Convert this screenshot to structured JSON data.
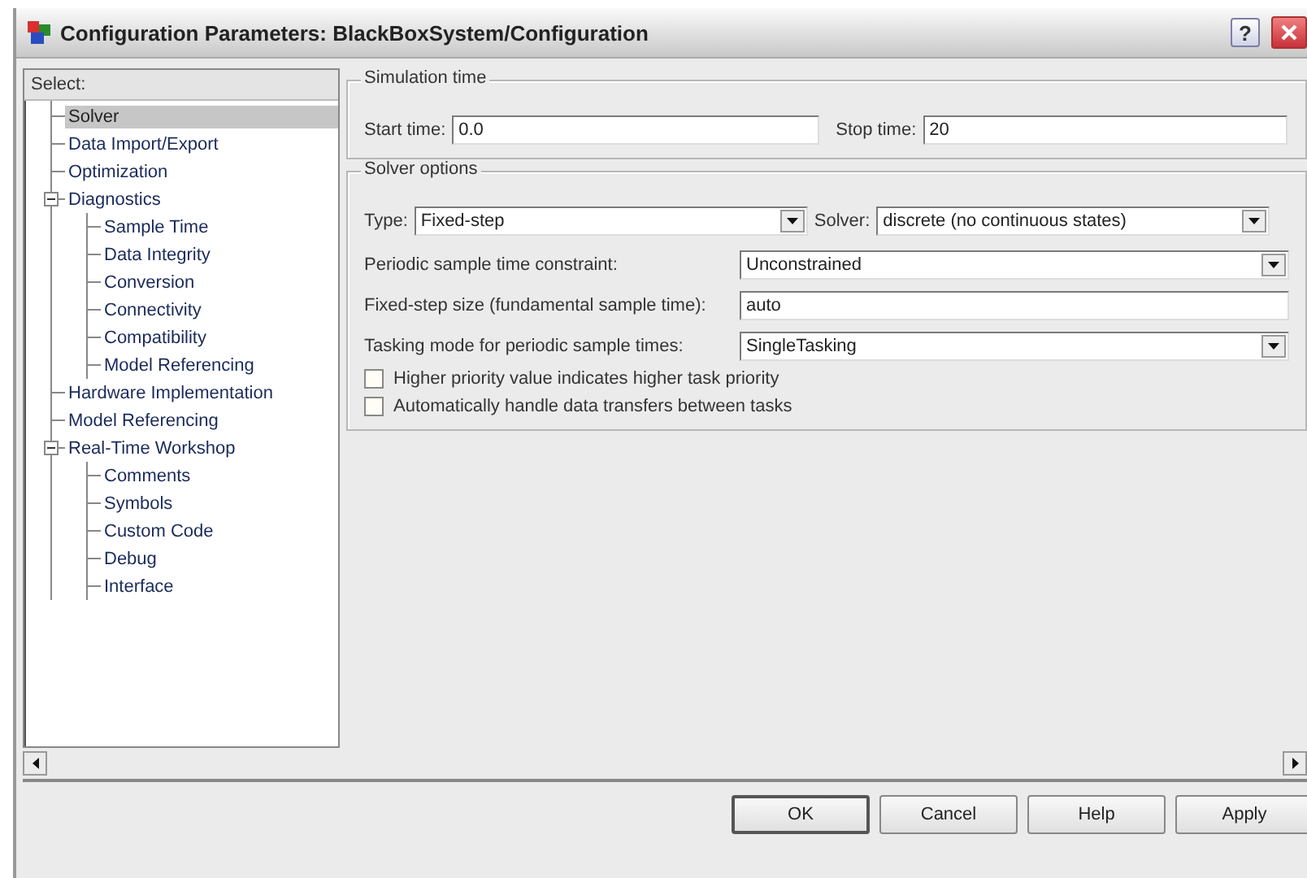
{
  "window": {
    "title": "Configuration Parameters: BlackBoxSystem/Configuration",
    "help_button": "?"
  },
  "tree": {
    "header": "Select:",
    "items": [
      {
        "label": "Solver",
        "selected": true
      },
      {
        "label": "Data Import/Export",
        "selected": false
      },
      {
        "label": "Optimization",
        "selected": false
      },
      {
        "label": "Diagnostics",
        "selected": false,
        "expanded": true,
        "children": [
          {
            "label": "Sample Time",
            "selected": false
          },
          {
            "label": "Data Integrity",
            "selected": false
          },
          {
            "label": "Conversion",
            "selected": false
          },
          {
            "label": "Connectivity",
            "selected": false
          },
          {
            "label": "Compatibility",
            "selected": false
          },
          {
            "label": "Model Referencing",
            "selected": false
          }
        ]
      },
      {
        "label": "Hardware Implementation",
        "selected": false
      },
      {
        "label": "Model Referencing",
        "selected": false
      },
      {
        "label": "Real-Time Workshop",
        "selected": false,
        "expanded": true,
        "children": [
          {
            "label": "Comments",
            "selected": false
          },
          {
            "label": "Symbols",
            "selected": false
          },
          {
            "label": "Custom Code",
            "selected": false
          },
          {
            "label": "Debug",
            "selected": false
          },
          {
            "label": "Interface",
            "selected": false
          }
        ]
      }
    ]
  },
  "simulation_time": {
    "title": "Simulation time",
    "fields": [
      {
        "label": "Start time:",
        "value": "0.0"
      },
      {
        "label": "Stop time:",
        "value": "20"
      }
    ]
  },
  "solver_options": {
    "title": "Solver options",
    "type": {
      "label": "Type:",
      "value": "Fixed-step"
    },
    "solver": {
      "label": "Solver:",
      "value": "discrete (no continuous states)"
    },
    "rows": [
      {
        "kind": "dropdown",
        "label": "Periodic sample time constraint:",
        "value": "Unconstrained"
      },
      {
        "kind": "text",
        "label": "Fixed-step size (fundamental sample time):",
        "value": "auto"
      },
      {
        "kind": "dropdown",
        "label": "Tasking mode for periodic sample times:",
        "value": "SingleTasking"
      }
    ],
    "checkboxes": [
      {
        "label": "Higher priority value indicates higher task priority",
        "checked": false
      },
      {
        "label": "Automatically handle data transfers between tasks",
        "checked": false
      }
    ]
  },
  "buttons": [
    {
      "label": "OK"
    },
    {
      "label": "Cancel"
    },
    {
      "label": "Help"
    },
    {
      "label": "Apply"
    }
  ]
}
